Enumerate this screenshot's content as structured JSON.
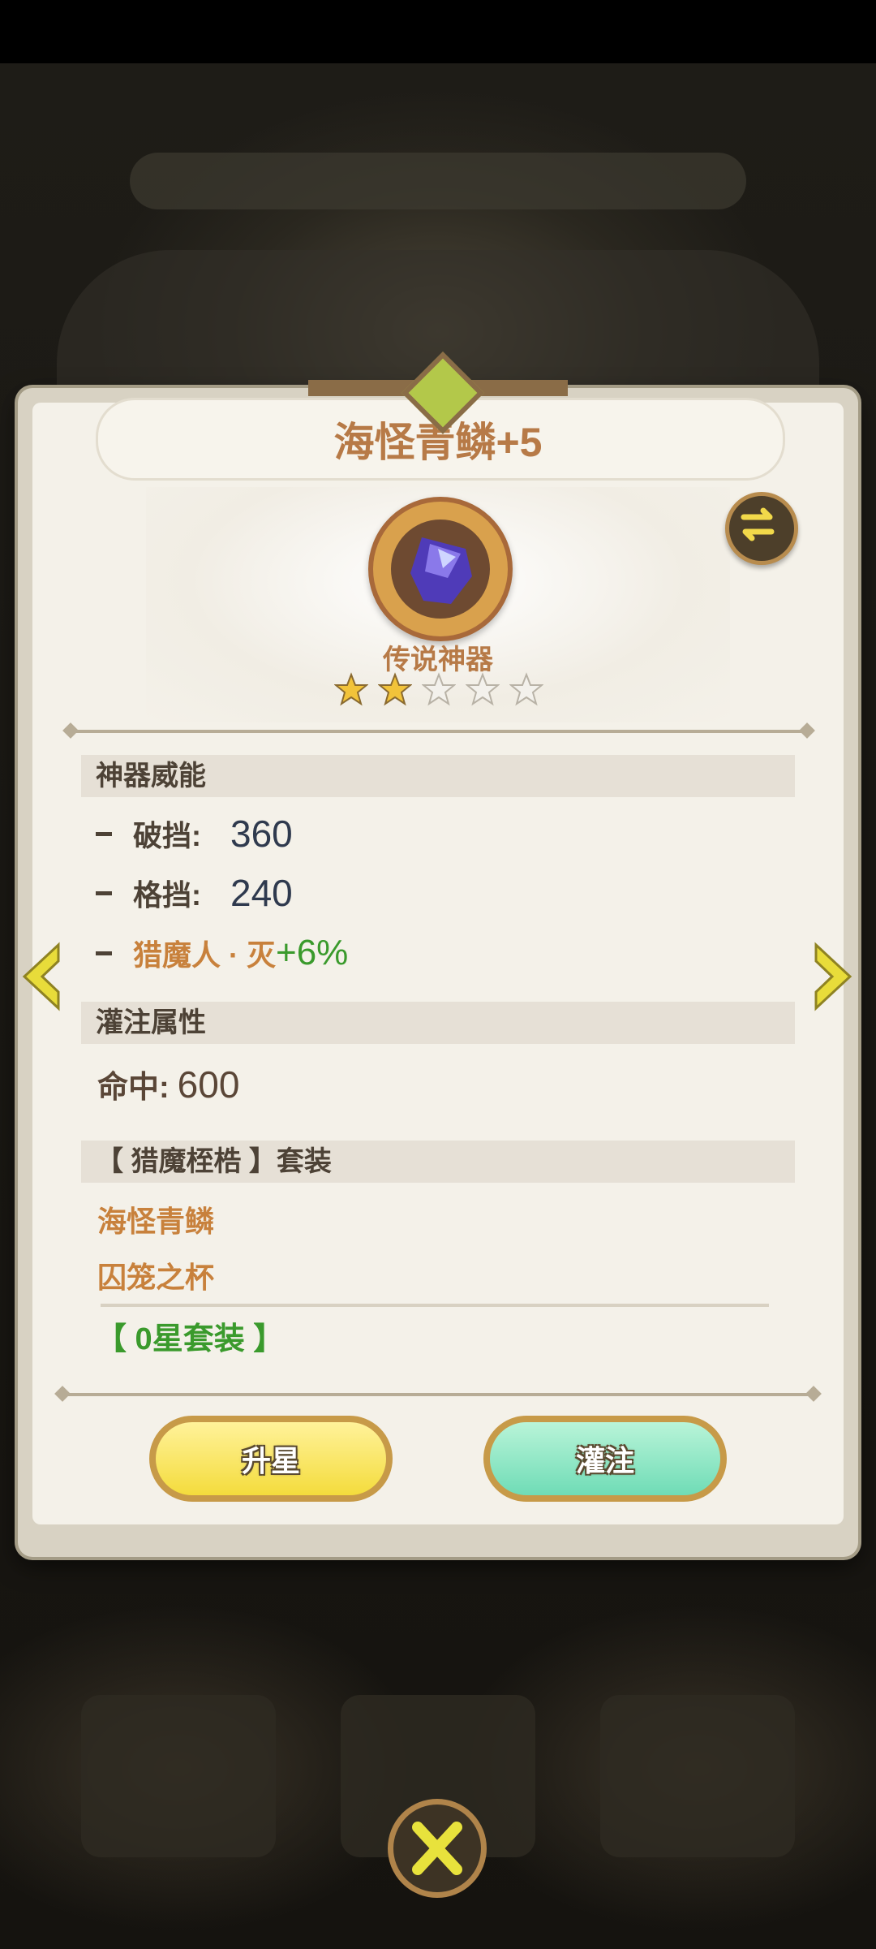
{
  "title": "海怪青鳞+5",
  "rarity": "传说神器",
  "stars": {
    "filled": 2,
    "total": 5
  },
  "power": {
    "header": "神器威能",
    "stats": [
      {
        "label": "破挡:",
        "value": "360"
      },
      {
        "label": "格挡:",
        "value": "240"
      }
    ],
    "bonus": {
      "label": "猎魔人 · 灭",
      "value": "+6%"
    }
  },
  "infuse": {
    "header": "灌注属性",
    "stat_label": "命中:",
    "stat_value": "600"
  },
  "set": {
    "header": "【 猎魔桎梏 】套装",
    "items": [
      "海怪青鳞",
      "囚笼之杯"
    ],
    "bonus": "【 0星套装 】"
  },
  "buttons": {
    "upgrade_star": "升星",
    "infuse": "灌注"
  },
  "colors": {
    "accent_orange": "#c8813c",
    "green": "#3a9a2c",
    "panel": "#f4f1e9"
  },
  "icons": [
    "swap-icon",
    "item-gem-icon",
    "star-icon",
    "left-arrow-icon",
    "right-arrow-icon",
    "close-icon"
  ]
}
